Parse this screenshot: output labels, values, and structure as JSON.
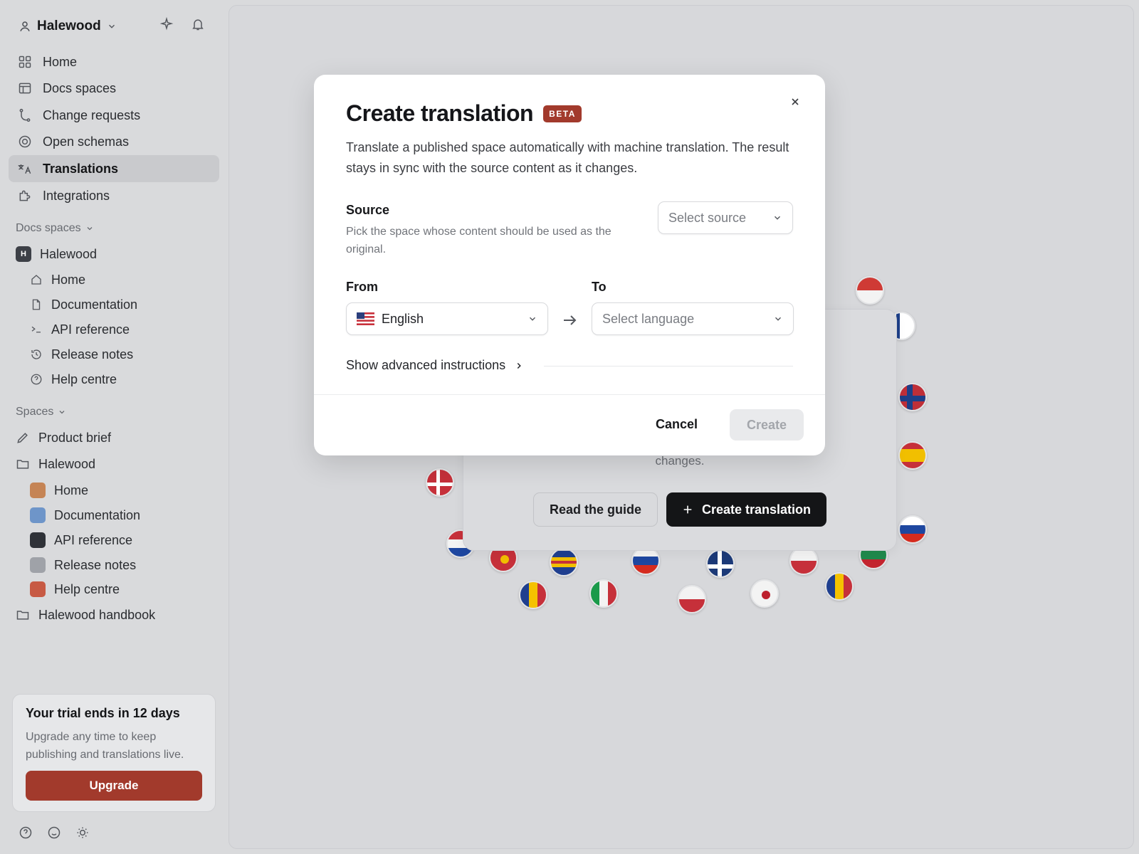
{
  "workspace": {
    "name": "Halewood"
  },
  "nav": [
    {
      "label": "Home",
      "icon": "grid-icon"
    },
    {
      "label": "Docs spaces",
      "icon": "layout-icon"
    },
    {
      "label": "Change requests",
      "icon": "git-branch-icon"
    },
    {
      "label": "Open schemas",
      "icon": "target-icon"
    },
    {
      "label": "Translations",
      "icon": "translate-icon",
      "active": true
    },
    {
      "label": "Integrations",
      "icon": "puzzle-icon"
    }
  ],
  "docs_spaces": {
    "section_label": "Docs spaces",
    "space_name": "Halewood",
    "space_badge": "H",
    "items": [
      "Home",
      "Documentation",
      "API reference",
      "Release notes",
      "Help centre"
    ]
  },
  "spaces": {
    "section_label": "Spaces",
    "product_brief": "Product brief",
    "folder_name": "Halewood",
    "items": [
      {
        "label": "Home",
        "color": "#c58455"
      },
      {
        "label": "Documentation",
        "color": "#6e95c9"
      },
      {
        "label": "API reference",
        "color": "#2f3238"
      },
      {
        "label": "Release notes",
        "color": "#9fa2a8"
      },
      {
        "label": "Help centre",
        "color": "#c75a44"
      }
    ],
    "handbook": "Halewood handbook"
  },
  "trial": {
    "title": "Your trial ends in 12 days",
    "body": "Upgrade any time to keep publishing and translations live.",
    "button": "Upgrade"
  },
  "background": {
    "description_tail": "changes.",
    "read_guide": "Read the guide",
    "create_translation": "Create translation"
  },
  "modal": {
    "title": "Create translation",
    "badge": "BETA",
    "description": "Translate a published space automatically with machine translation. The result stays in sync with the source content as it changes.",
    "source_label": "Source",
    "source_help": "Pick the space whose content should be used as the original.",
    "source_placeholder": "Select source",
    "from_label": "From",
    "from_value": "English",
    "to_label": "To",
    "to_placeholder": "Select language",
    "advanced": "Show advanced instructions",
    "cancel": "Cancel",
    "create": "Create"
  },
  "colors": {
    "accent": "#a23a2c",
    "primary_dark": "#141517",
    "sidebar_active": "#c9cacd"
  }
}
